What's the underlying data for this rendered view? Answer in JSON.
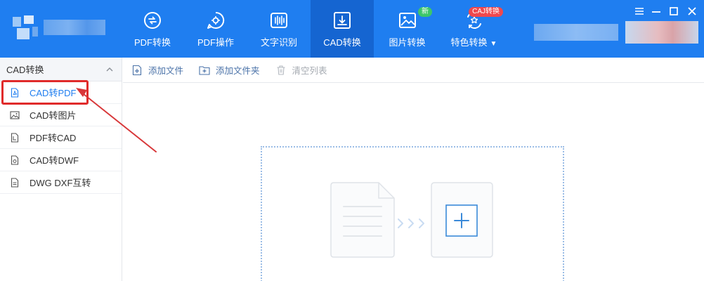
{
  "nav": {
    "items": [
      {
        "label": "PDF转换",
        "icon": "pdf-convert-icon"
      },
      {
        "label": "PDF操作",
        "icon": "pdf-operate-icon"
      },
      {
        "label": "文字识别",
        "icon": "ocr-icon"
      },
      {
        "label": "CAD转换",
        "icon": "cad-convert-icon",
        "active": true
      },
      {
        "label": "图片转换",
        "icon": "image-convert-icon",
        "badge": "新"
      },
      {
        "label": "特色转换",
        "icon": "special-convert-icon",
        "badge": "CAJ转换",
        "caret": "▼"
      }
    ]
  },
  "window_controls": [
    "menu-icon",
    "minimize-icon",
    "maximize-icon",
    "close-icon"
  ],
  "sidebar": {
    "header": "CAD转换",
    "collapse_icon": "chevron-up-icon",
    "items": [
      {
        "label": "CAD转PDF",
        "icon": "pdf-file-icon",
        "selected": true
      },
      {
        "label": "CAD转图片",
        "icon": "image-file-icon"
      },
      {
        "label": "PDF转CAD",
        "icon": "cad-file-icon"
      },
      {
        "label": "CAD转DWF",
        "icon": "dwf-file-icon"
      },
      {
        "label": "DWG DXF互转",
        "icon": "dwg-file-icon"
      }
    ]
  },
  "toolbar": {
    "add_file": "添加文件",
    "add_folder": "添加文件夹",
    "clear_list": "清空列表"
  },
  "colors": {
    "brand": "#1f7ef0",
    "active_tab": "#1565d1",
    "highlight": "#e02b2b",
    "badge_new": "#3cc66a",
    "badge_caj": "#f0484d"
  }
}
